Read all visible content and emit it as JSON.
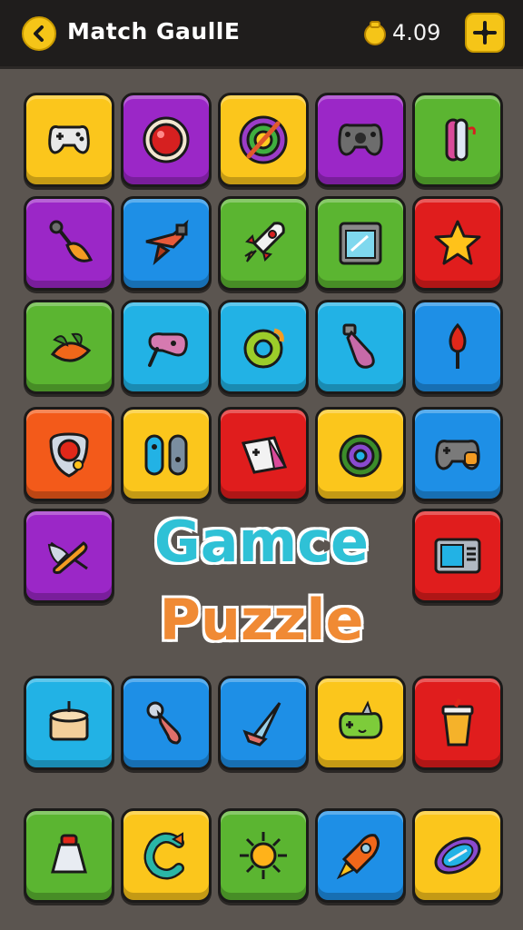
{
  "header": {
    "title": "Match GaullE",
    "coins": "4.09",
    "back_icon": "chevron-left-icon",
    "coin_icon": "coin-bag-icon",
    "settings_icon": "settings-icon"
  },
  "center": {
    "line1": "Gamce",
    "line2": "Puzzle"
  },
  "tiles": [
    {
      "icon": "gamepad-icon",
      "color": "yellow"
    },
    {
      "icon": "red-ball-icon",
      "color": "purple"
    },
    {
      "icon": "target-icon",
      "color": "yellow"
    },
    {
      "icon": "controller-icon",
      "color": "purple"
    },
    {
      "icon": "joycon-icon",
      "color": "green"
    },
    {
      "icon": "leaf-key-icon",
      "color": "purple"
    },
    {
      "icon": "jet-icon",
      "color": "blue"
    },
    {
      "icon": "rocket-icon",
      "color": "green"
    },
    {
      "icon": "monitor-icon",
      "color": "green"
    },
    {
      "icon": "star-icon",
      "color": "red"
    },
    {
      "icon": "leaves-icon",
      "color": "green"
    },
    {
      "icon": "joystick-icon",
      "color": "cyan"
    },
    {
      "icon": "ring-icon",
      "color": "cyan"
    },
    {
      "icon": "bottle-icon",
      "color": "cyan"
    },
    {
      "icon": "torch-icon",
      "color": "blue"
    },
    {
      "icon": "shield-icon",
      "color": "orange"
    },
    {
      "icon": "switch-icon",
      "color": "yellow"
    },
    {
      "icon": "card-controller-icon",
      "color": "red"
    },
    {
      "icon": "donut-icon",
      "color": "yellow"
    },
    {
      "icon": "gamepad-2-icon",
      "color": "blue"
    },
    {
      "icon": "feather-icon",
      "color": "purple"
    },
    {
      "icon": "tv-icon",
      "color": "red"
    },
    {
      "icon": "drum-icon",
      "color": "cyan"
    },
    {
      "icon": "key-icon",
      "color": "blue"
    },
    {
      "icon": "cone-icon",
      "color": "blue"
    },
    {
      "icon": "frog-controller-icon",
      "color": "yellow"
    },
    {
      "icon": "cup-icon",
      "color": "red"
    },
    {
      "icon": "bell-icon",
      "color": "green"
    },
    {
      "icon": "letter-c-icon",
      "color": "yellow"
    },
    {
      "icon": "sun-icon",
      "color": "green"
    },
    {
      "icon": "rocket-2-icon",
      "color": "blue"
    },
    {
      "icon": "football-icon",
      "color": "yellow"
    }
  ]
}
